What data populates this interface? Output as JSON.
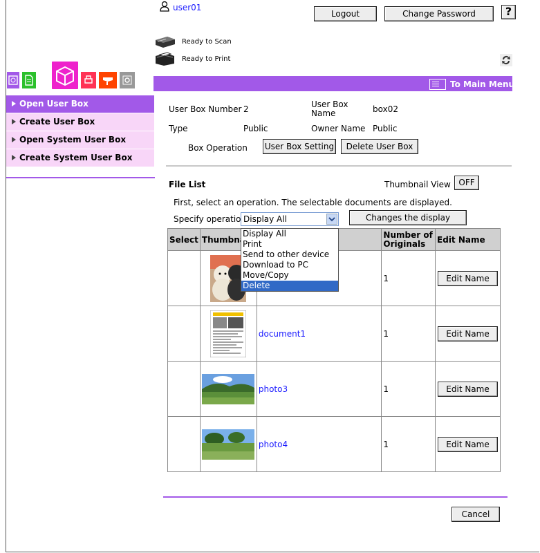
{
  "header": {
    "username": "user01",
    "logout_label": "Logout",
    "change_password_label": "Change Password",
    "help_label": "?",
    "scan_status": "Ready to Scan",
    "print_status": "Ready to Print",
    "main_menu_label": "To Main Menu"
  },
  "sidebar": {
    "items": [
      {
        "label": "Open User Box",
        "active": true
      },
      {
        "label": "Create User Box",
        "active": false
      },
      {
        "label": "Open System User Box",
        "active": false
      },
      {
        "label": "Create System User Box",
        "active": false
      }
    ]
  },
  "box_info": {
    "number_label": "User Box Number",
    "number_value": "2",
    "name_label": "User Box Name",
    "name_value": "box02",
    "type_label": "Type",
    "type_value": "Public",
    "owner_label": "Owner Name",
    "owner_value": "Public",
    "operation_label": "Box Operation",
    "setting_button": "User Box Setting",
    "delete_button": "Delete User Box"
  },
  "file_list": {
    "title": "File List",
    "thumbnail_view_label": "Thumbnail View",
    "thumbnail_toggle": "OFF",
    "instruction": "First, select an operation. The selectable documents are displayed.",
    "specify_label": "Specify operation",
    "selected_operation": "Display All",
    "changes_display_button": "Changes the display",
    "operations": [
      "Display All",
      "Print",
      "Send to other device",
      "Download to PC",
      "Move/Copy",
      "Delete"
    ],
    "highlighted_operation": "Delete",
    "columns": {
      "select": "Select",
      "thumbnail": "Thumbnail",
      "originals": "Number of Originals",
      "edit": "Edit Name"
    },
    "rows": [
      {
        "name": "",
        "originals": "1",
        "edit_label": "Edit Name",
        "thumb": "dolls-photo"
      },
      {
        "name": "document1",
        "originals": "1",
        "edit_label": "Edit Name",
        "thumb": "document"
      },
      {
        "name": "photo3",
        "originals": "1",
        "edit_label": "Edit Name",
        "thumb": "landscape"
      },
      {
        "name": "photo4",
        "originals": "1",
        "edit_label": "Edit Name",
        "thumb": "landscape"
      }
    ]
  },
  "footer": {
    "cancel_label": "Cancel"
  }
}
